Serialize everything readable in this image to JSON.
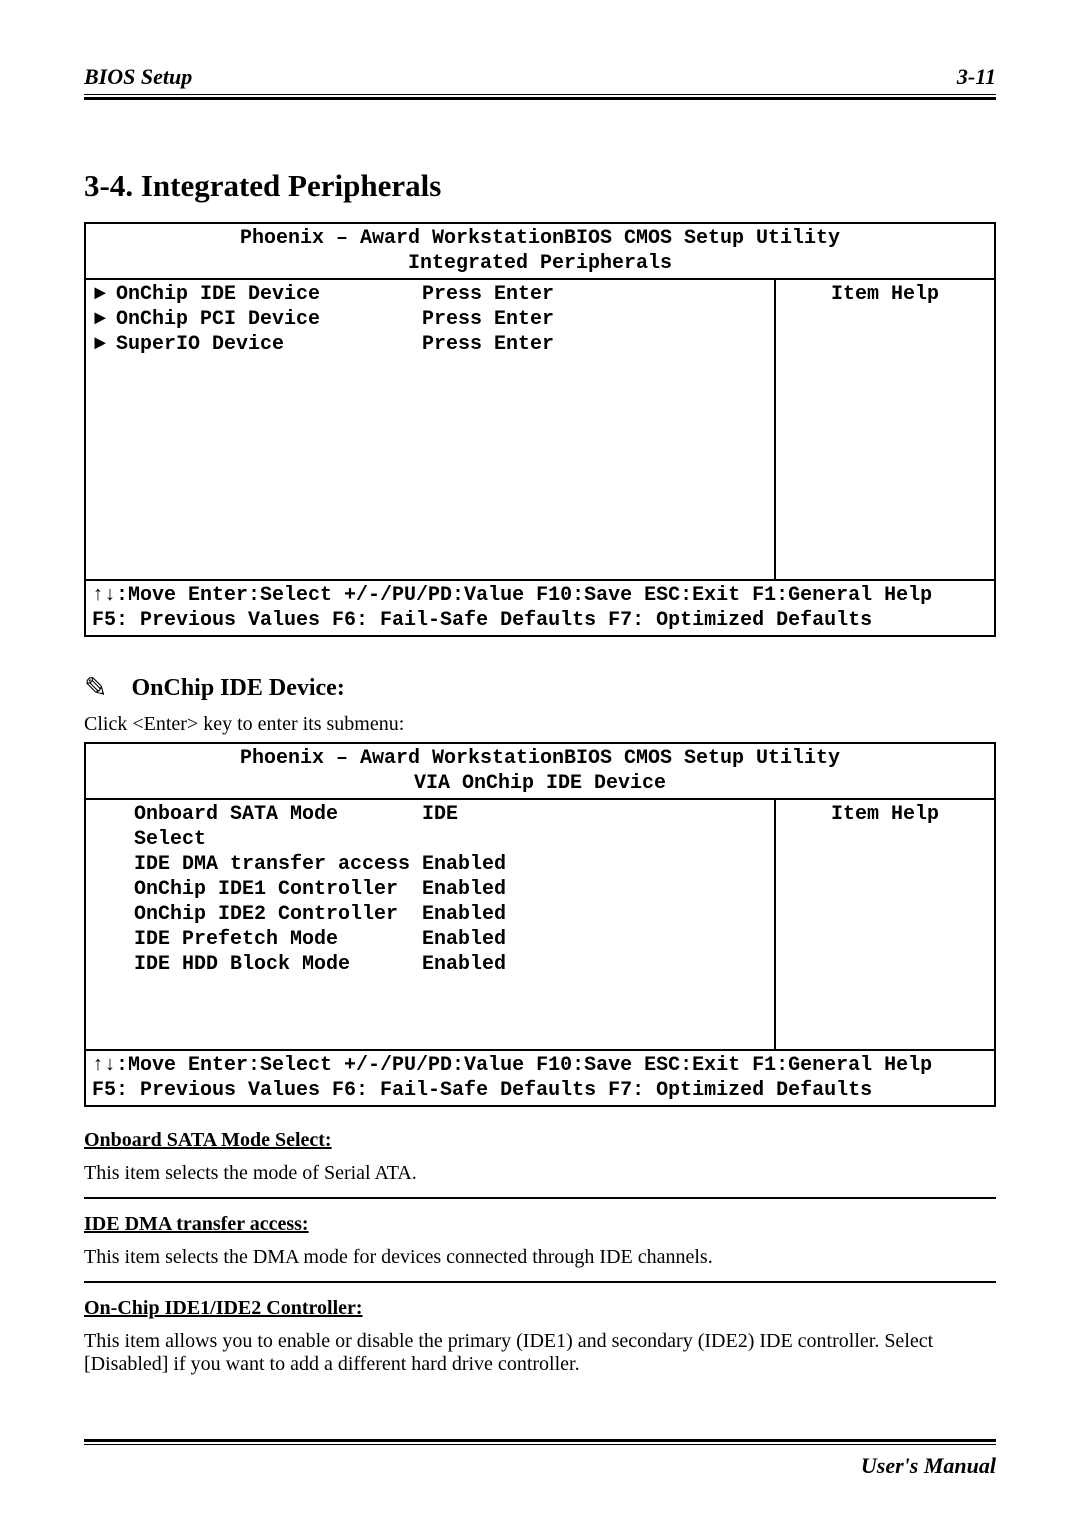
{
  "header": {
    "left": "BIOS Setup",
    "right": "3-11"
  },
  "section_title": "3-4.  Integrated Peripherals",
  "bios1": {
    "title1": "Phoenix – Award WorkstationBIOS CMOS Setup Utility",
    "title2": "Integrated Peripherals",
    "help_label": "Item Help",
    "rows": [
      {
        "arrow": "►",
        "label": "OnChip IDE Device",
        "value": "Press Enter"
      },
      {
        "arrow": "►",
        "label": "OnChip PCI Device",
        "value": "Press Enter"
      },
      {
        "arrow": "►",
        "label": "SuperIO Device",
        "value": "Press Enter"
      }
    ],
    "footer1": "↑↓:Move Enter:Select +/-/PU/PD:Value F10:Save ESC:Exit F1:General Help",
    "footer2": "F5: Previous Values   F6: Fail-Safe Defaults   F7: Optimized Defaults"
  },
  "sub_heading": "OnChip IDE Device:",
  "sub_intro": "Click <Enter> key to enter its submenu:",
  "bios2": {
    "title1": "Phoenix – Award WorkstationBIOS CMOS Setup Utility",
    "title2": "VIA OnChip IDE Device",
    "help_label": "Item Help",
    "rows": [
      {
        "label": "Onboard SATA Mode Select",
        "value": "IDE"
      },
      {
        "label": "IDE DMA transfer access",
        "value": "Enabled"
      },
      {
        "label": "OnChip IDE1 Controller",
        "value": "Enabled"
      },
      {
        "label": "OnChip IDE2 Controller",
        "value": "Enabled"
      },
      {
        "label": "IDE Prefetch Mode",
        "value": "Enabled"
      },
      {
        "label": "IDE HDD Block Mode",
        "value": "Enabled"
      }
    ],
    "footer1": "↑↓:Move Enter:Select +/-/PU/PD:Value F10:Save ESC:Exit F1:General Help",
    "footer2": "F5: Previous Values   F6: Fail-Safe Defaults   F7: Optimized Defaults"
  },
  "options": [
    {
      "head": "Onboard SATA Mode Select:",
      "text": "This item selects the mode of Serial ATA."
    },
    {
      "head": "IDE DMA transfer access:",
      "text": "This item selects the DMA mode for devices connected through IDE channels."
    },
    {
      "head": "On-Chip IDE1/IDE2 Controller:",
      "text": "This item allows you to enable or disable the primary (IDE1) and secondary (IDE2) IDE controller. Select [Disabled] if you want to add a different hard drive controller."
    }
  ],
  "footer": "User's Manual"
}
